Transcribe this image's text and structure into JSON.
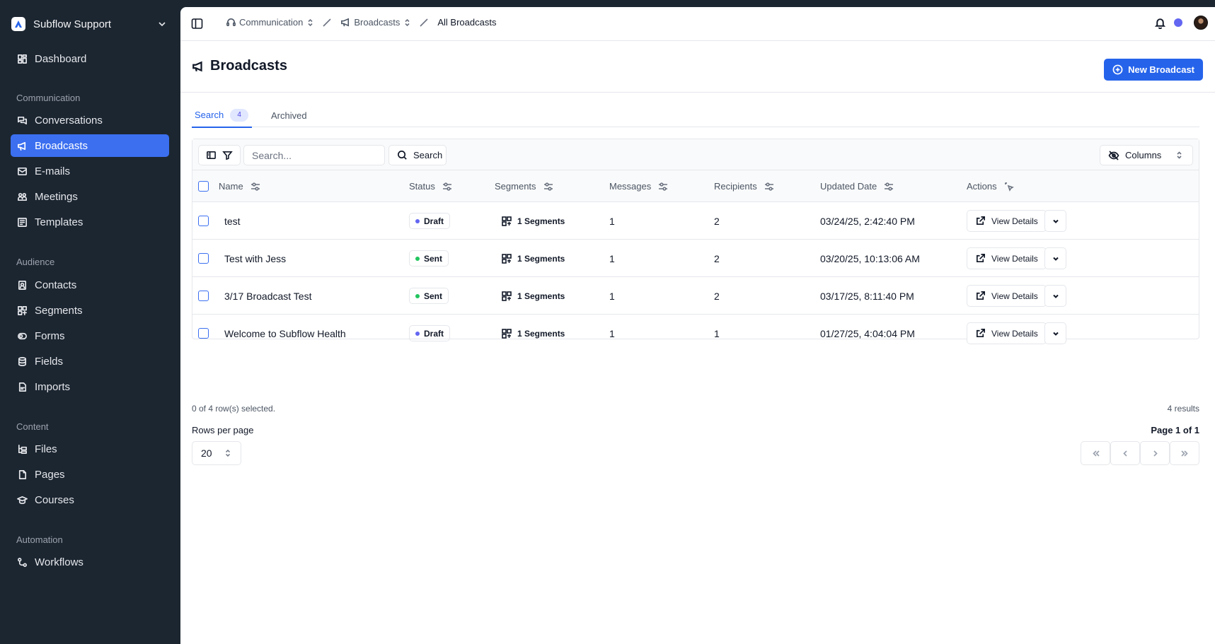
{
  "sidebar": {
    "workspace": "Subflow Support",
    "dashboard": "Dashboard",
    "sections": {
      "communication": "Communication",
      "audience": "Audience",
      "content": "Content",
      "automation": "Automation"
    },
    "items": {
      "conversations": "Conversations",
      "broadcasts": "Broadcasts",
      "emails": "E-mails",
      "meetings": "Meetings",
      "templates": "Templates",
      "contacts": "Contacts",
      "segments": "Segments",
      "forms": "Forms",
      "fields": "Fields",
      "imports": "Imports",
      "files": "Files",
      "pages": "Pages",
      "courses": "Courses",
      "workflows": "Workflows"
    },
    "active": "broadcasts"
  },
  "breadcrumb": {
    "level1": "Communication",
    "level2": "Broadcasts",
    "current": "All Broadcasts"
  },
  "header": {
    "title": "Broadcasts",
    "new_button": "New Broadcast"
  },
  "tabs": {
    "search": "Search",
    "search_count": "4",
    "archived": "Archived"
  },
  "toolbar": {
    "search_placeholder": "Search...",
    "search_button": "Search",
    "columns_button": "Columns"
  },
  "table": {
    "columns": {
      "name": "Name",
      "status": "Status",
      "segments": "Segments",
      "messages": "Messages",
      "recipients": "Recipients",
      "updated": "Updated Date",
      "actions": "Actions"
    },
    "rows": [
      {
        "name": "test",
        "status": "Draft",
        "segments": "1 Segments",
        "messages": "1",
        "recipients": "2",
        "updated": "03/24/25, 2:42:40 PM",
        "action": "View Details"
      },
      {
        "name": "Test with Jess",
        "status": "Sent",
        "segments": "1 Segments",
        "messages": "1",
        "recipients": "2",
        "updated": "03/20/25, 10:13:06 AM",
        "action": "View Details"
      },
      {
        "name": "3/17 Broadcast Test",
        "status": "Sent",
        "segments": "1 Segments",
        "messages": "1",
        "recipients": "2",
        "updated": "03/17/25, 8:11:40 PM",
        "action": "View Details"
      },
      {
        "name": "Welcome to Subflow Health",
        "status": "Draft",
        "segments": "1 Segments",
        "messages": "1",
        "recipients": "1",
        "updated": "01/27/25, 4:04:04 PM",
        "action": "View Details"
      }
    ]
  },
  "footer": {
    "selected": "0 of 4 row(s) selected.",
    "results": "4 results",
    "rows_per_page_label": "Rows per page",
    "rows_per_page": "20",
    "page": "Page 1 of 1"
  },
  "colors": {
    "accent": "#2563eb",
    "sidebar_bg": "#1c2631",
    "draft_dot": "#6366f1",
    "sent_dot": "#22c55e"
  }
}
